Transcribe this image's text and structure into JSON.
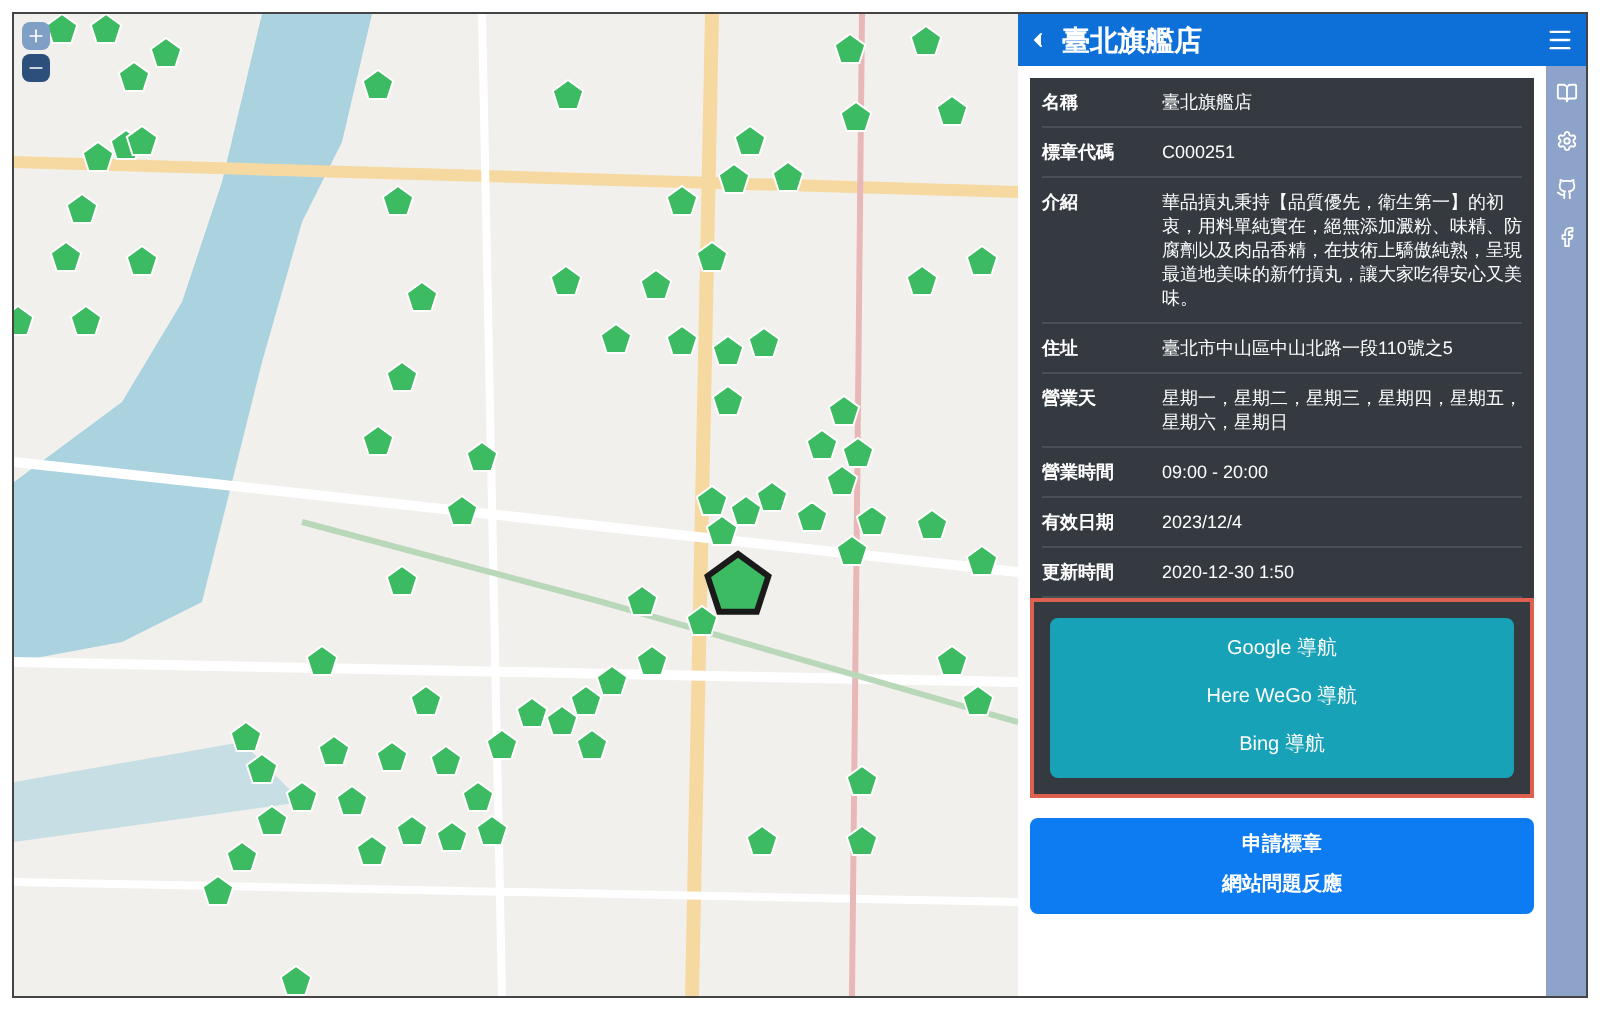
{
  "panel": {
    "title": "臺北旗艦店",
    "details": [
      {
        "label": "名稱",
        "value": "臺北旗艦店"
      },
      {
        "label": "標章代碼",
        "value": "C000251"
      },
      {
        "label": "介紹",
        "value": "華品摃丸秉持【品質優先，衛生第一】的初衷，用料單純實在，絕無添加澱粉、味精、防腐劑以及肉品香精，在技術上驕傲純熟，呈現最道地美味的新竹摃丸，讓大家吃得安心又美味。"
      },
      {
        "label": "住址",
        "value": "臺北市中山區中山北路一段110號之5"
      },
      {
        "label": "營業天",
        "value": "星期一，星期二，星期三，星期四，星期五，星期六，星期日"
      },
      {
        "label": "營業時間",
        "value": "09:00 - 20:00"
      },
      {
        "label": "有效日期",
        "value": "2023/12/4"
      },
      {
        "label": "更新時間",
        "value": "2020-12-30 1:50"
      }
    ],
    "nav_links": [
      "Google 導航",
      "Here WeGo 導航",
      "Bing 導航"
    ],
    "actions": [
      "申請標章",
      "網站問題反應"
    ]
  }
}
